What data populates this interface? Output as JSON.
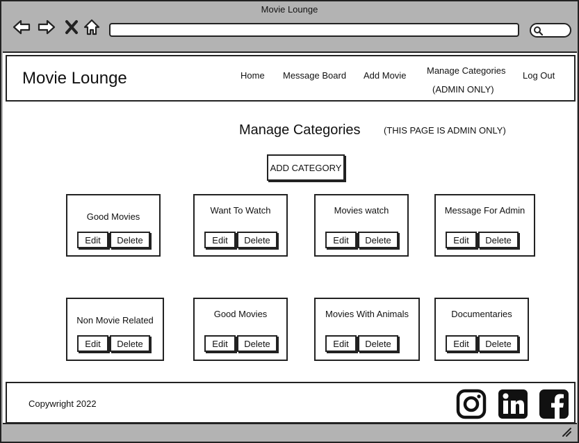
{
  "window": {
    "title": "Movie Lounge"
  },
  "browser": {
    "icons": [
      "back-icon",
      "forward-icon",
      "close-icon",
      "home-icon",
      "search-icon"
    ],
    "url": ""
  },
  "header": {
    "brand": "Movie Lounge",
    "nav": {
      "home": "Home",
      "message_board": "Message Board",
      "add_movie": "Add Movie",
      "manage_categories": "Manage Categories",
      "manage_categories_note": "(ADMIN ONLY)",
      "log_out": "Log Out"
    }
  },
  "main": {
    "title": "Manage Categories",
    "admin_note": "(THIS PAGE IS ADMIN ONLY)",
    "add_button": "ADD CATEGORY",
    "edit_label": "Edit",
    "delete_label": "Delete",
    "categories": [
      "Good Movies",
      "Want To Watch",
      "Movies watch",
      "Message For Admin",
      "Non Movie Related",
      "Good Movies",
      "Movies With Animals",
      "Documentaries"
    ]
  },
  "footer": {
    "copyright": "Copywright 2022",
    "social": [
      "instagram-icon",
      "linkedin-icon",
      "facebook-icon"
    ]
  }
}
